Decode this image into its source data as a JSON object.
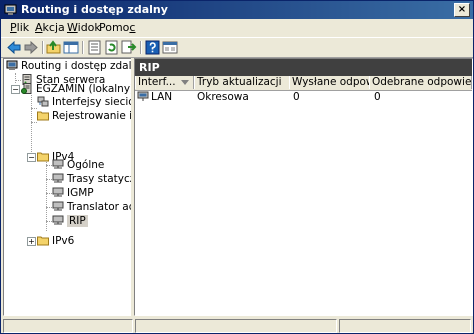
{
  "window": {
    "title": "Routing i dostęp zdalny",
    "close_glyph": "×"
  },
  "menu": [
    {
      "before": "",
      "accel": "P",
      "after": "lik"
    },
    {
      "before": "",
      "accel": "A",
      "after": "kcja"
    },
    {
      "before": "",
      "accel": "W",
      "after": "idok"
    },
    {
      "before": "Pomo",
      "accel": "c",
      "after": ""
    }
  ],
  "toolbar": {
    "buttons": [
      "back-arrow-icon",
      "forward-arrow-icon",
      "up-folder-icon",
      "show-tree-icon",
      "properties-icon",
      "refresh-icon",
      "export-icon",
      "help-icon",
      "console-icon"
    ]
  },
  "tree": {
    "root": "Routing i dostęp zdalny",
    "server_status": "Stan serwera",
    "server": "EGZAMIN (lokalny)",
    "network_interfaces": "Interfejsy sieciowe",
    "logging": "Rejestrowanie i zasac",
    "ipv4": "IPv4",
    "general": "Ogólne",
    "static_routes": "Trasy statyczne",
    "igmp": "IGMP",
    "nat": "Translator adresó",
    "rip": "RIP",
    "ipv6": "IPv6",
    "expand_minus": "−",
    "expand_plus": "+"
  },
  "details": {
    "header": "RIP",
    "columns": [
      "Interf...",
      "Tryb aktualizacji",
      "Wysłane odpowiedzi",
      "Odebrane odpowiedzi"
    ],
    "rows": [
      {
        "interface": "LAN",
        "mode": "Okresowa",
        "sent": "0",
        "received": "0"
      }
    ]
  }
}
